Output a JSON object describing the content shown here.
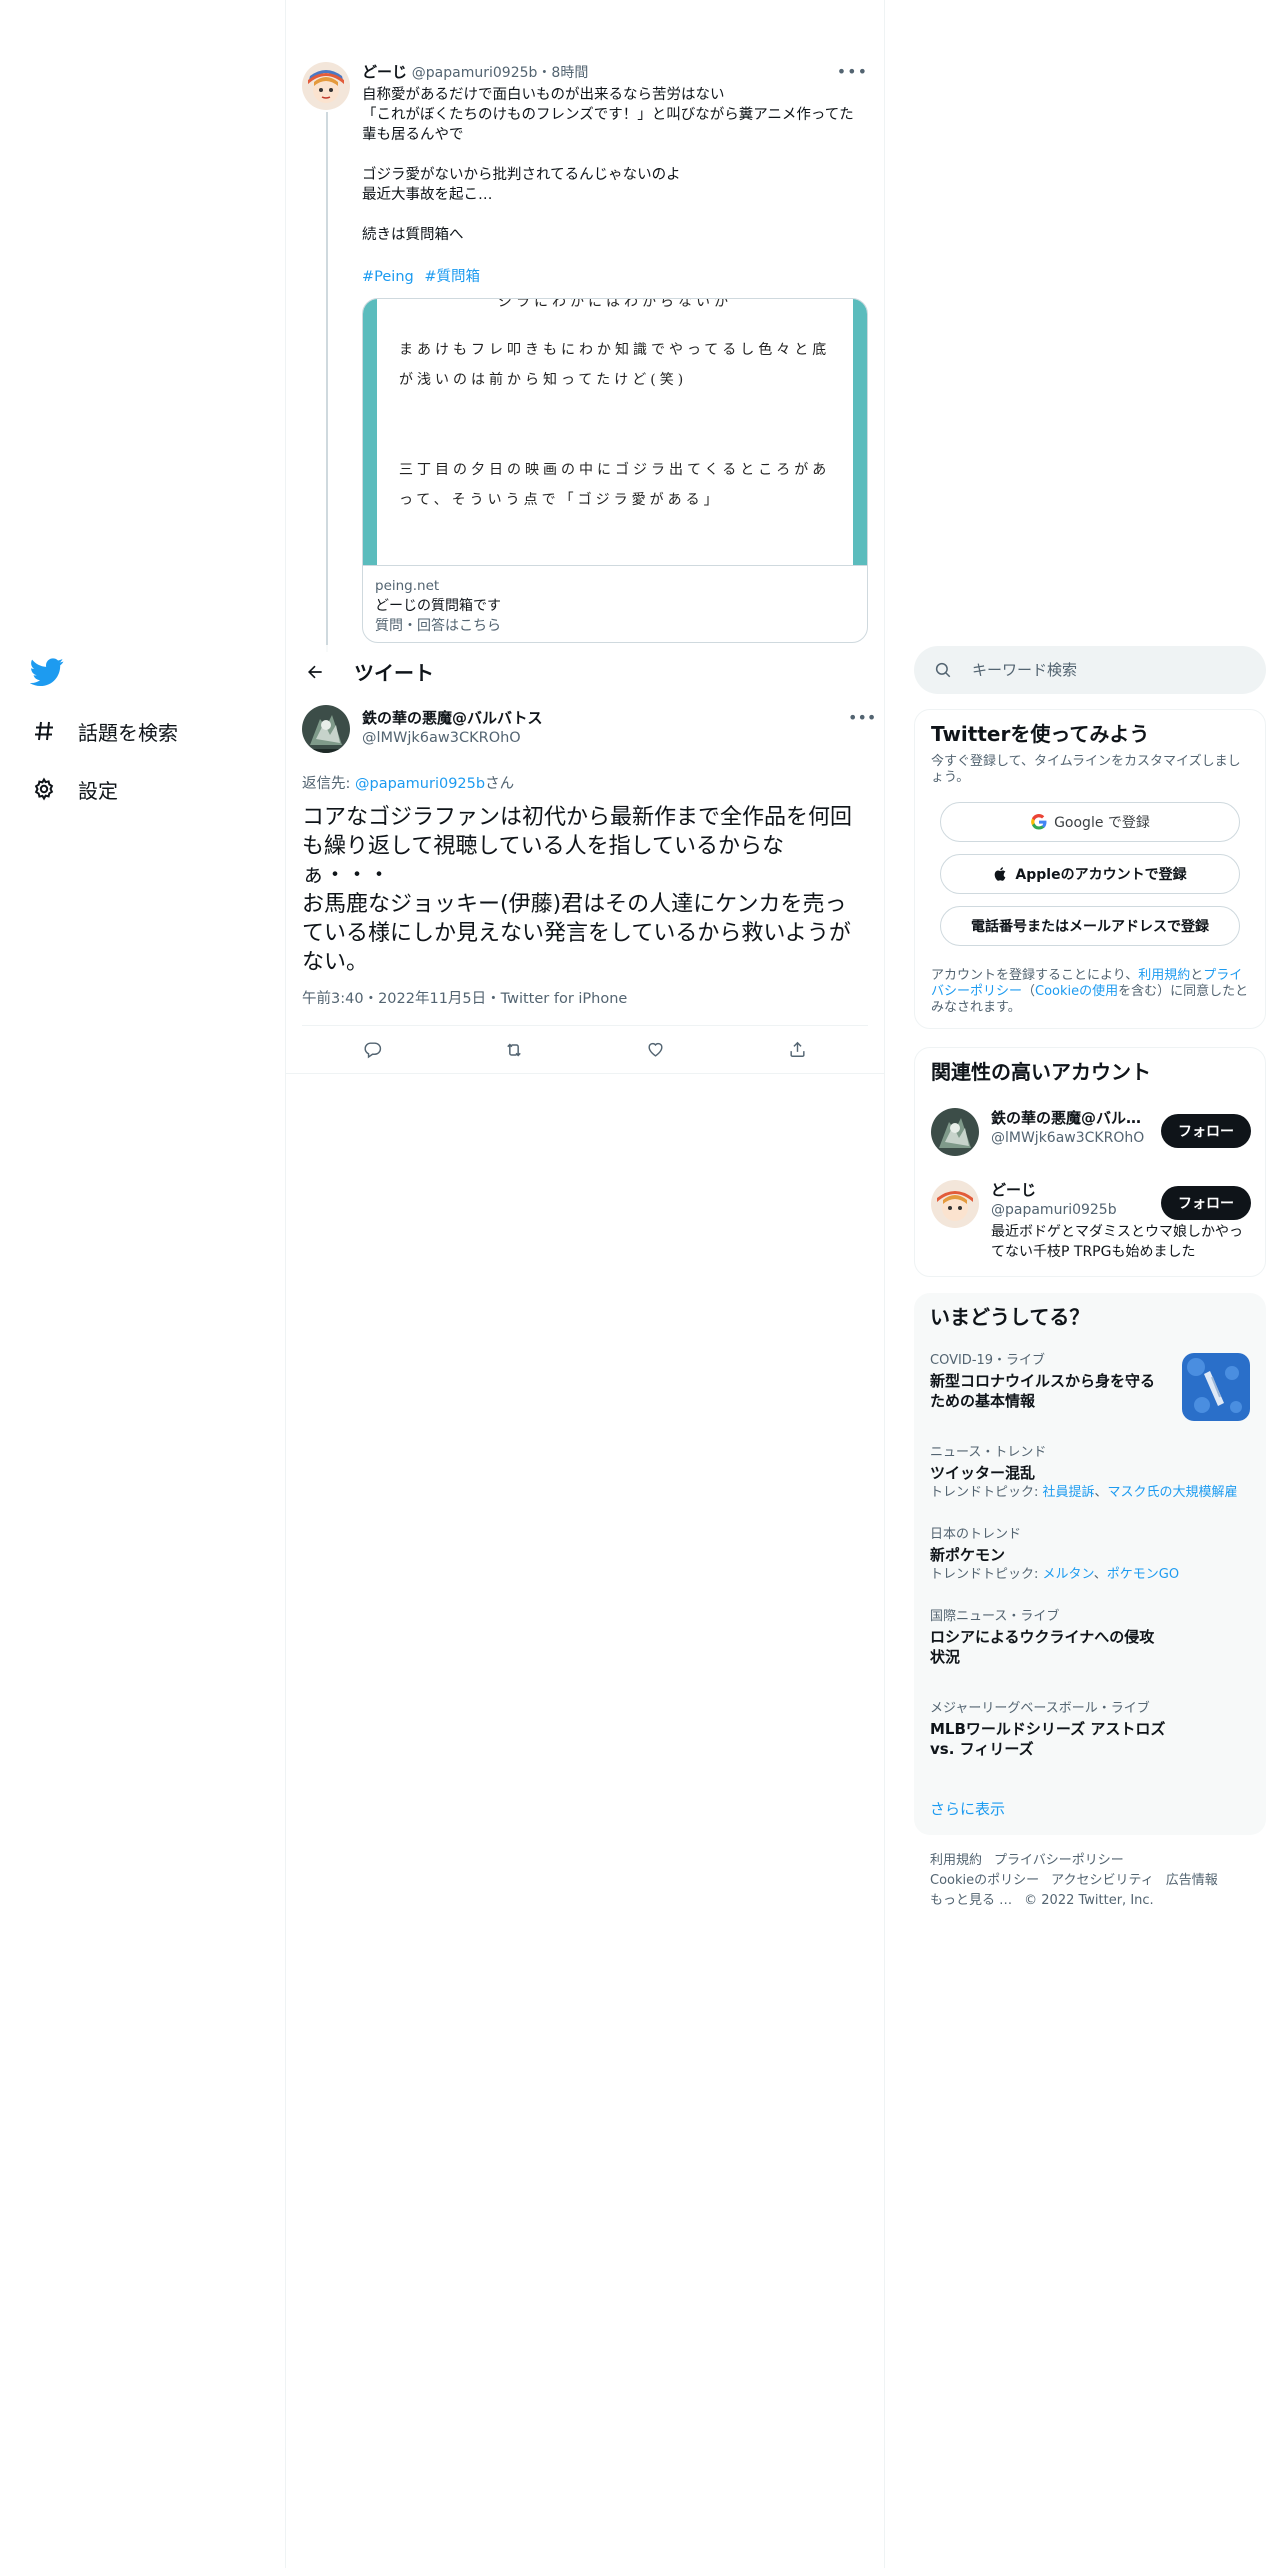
{
  "nav": {
    "explore_label": "話題を検索",
    "settings_label": "設定"
  },
  "parent_tweet": {
    "name": "どーじ",
    "handle": "@papamuri0925b",
    "separator": "・",
    "time": "8時間",
    "paragraphs": [
      "自称愛があるだけで面白いものが出来るなら苦労はない\n「これがぼくたちのけものフレンズです！」と叫びながら糞アニメ作ってた輩も居るんやで",
      "ゴジラ愛がないから批判されてるんじゃないのよ\n最近大事故を起こ…",
      "続きは質問箱へ"
    ],
    "hashtags": [
      "#Peing",
      "#質問箱"
    ],
    "card": {
      "image_lines": [
        "ジラにわかにはわからないか",
        "まあけもフレ叩きもにわか知識でやってるし色々と底が浅いのは前から知ってたけど(笑)",
        "",
        "三丁目の夕日の映画の中にゴジラ出てくるところがあって、そういう点で「ゴジラ愛がある」"
      ],
      "domain": "peing.net",
      "title": "どーじの質問箱です",
      "description": "質問・回答はこちら"
    }
  },
  "header": {
    "title": "ツイート"
  },
  "focused_tweet": {
    "name": "鉄の華の悪魔@バルバトス",
    "handle": "@lMWjk6aw3CKROhO",
    "reply_prefix": "返信先: ",
    "reply_mention": "@papamuri0925b",
    "reply_suffix": "さん",
    "text": "コアなゴジラファンは初代から最新作まで全作品を何回も繰り返して視聴している人を指しているからなぁ・・・\nお馬鹿なジョッキー(伊藤)君はその人達にケンカを売っている様にしか見えない発言をしているから救いようがない。",
    "time": "午前3:40",
    "date": "2022年11月5日",
    "source": "Twitter for iPhone",
    "separator": "・"
  },
  "search": {
    "placeholder": "キーワード検索"
  },
  "signup": {
    "title": "Twitterを使ってみよう",
    "subtitle": "今すぐ登録して、タイムラインをカスタマイズしましょう。",
    "google_label": "Google で登録",
    "apple_label": "Appleのアカウントで登録",
    "phone_label": "電話番号またはメールアドレスで登録",
    "legal_1": "アカウントを登録することにより、",
    "legal_terms": "利用規約",
    "legal_2": "と",
    "legal_privacy": "プライバシーポリシー",
    "legal_3": "（",
    "legal_cookie": "Cookieの使用",
    "legal_4": "を含む）に同意したとみなされます。"
  },
  "related": {
    "title": "関連性の高いアカウント",
    "follow_label": "フォロー",
    "accounts": [
      {
        "name": "鉄の華の悪魔@バルバトス",
        "handle": "@lMWjk6aw3CKROhO",
        "bio": ""
      },
      {
        "name": "どーじ",
        "handle": "@papamuri0925b",
        "bio": "最近ボドゲとマダミスとウマ娘しかやってない千枝P TRPGも始めました"
      }
    ]
  },
  "trends": {
    "title": "いまどうしてる？",
    "items": [
      {
        "context": "COVID-19・ライブ",
        "name": "新型コロナウイルスから身を守るための基本情報",
        "related_prefix": "",
        "related": []
      },
      {
        "context": "ニュース・トレンド",
        "name": "ツイッター混乱",
        "related_prefix": "トレンドトピック: ",
        "related": [
          "社員提訴",
          "マスク氏の大規模解雇"
        ]
      },
      {
        "context": "日本のトレンド",
        "name": "新ポケモン",
        "related_prefix": "トレンドトピック: ",
        "related": [
          "メルタン",
          "ポケモンGO"
        ]
      },
      {
        "context": "国際ニュース・ライブ",
        "name": "ロシアによるウクライナへの侵攻状況",
        "related_prefix": "",
        "related": []
      },
      {
        "context": "メジャーリーグベースボール・ライブ",
        "name": "MLBワールドシリーズ アストロズ vs. フィリーズ",
        "related_prefix": "",
        "related": []
      }
    ],
    "show_more": "さらに表示"
  },
  "footer": {
    "links": [
      "利用規約",
      "プライバシーポリシー",
      "Cookieのポリシー",
      "アクセシビリティ",
      "広告情報",
      "もっと見る …"
    ],
    "copyright": "© 2022 Twitter, Inc."
  },
  "colors": {
    "accent": "#1d9bf0",
    "text": "#0f1419",
    "muted": "#536471",
    "border": "#eff3f4",
    "card_teal": "#5bbcbd"
  },
  "icons": {
    "logo": "twitter-bird-icon",
    "explore": "hashtag-icon",
    "settings": "gear-icon",
    "back": "back-arrow-icon",
    "reply": "reply-icon",
    "retweet": "retweet-icon",
    "like": "heart-icon",
    "share": "share-icon",
    "search": "search-icon"
  }
}
